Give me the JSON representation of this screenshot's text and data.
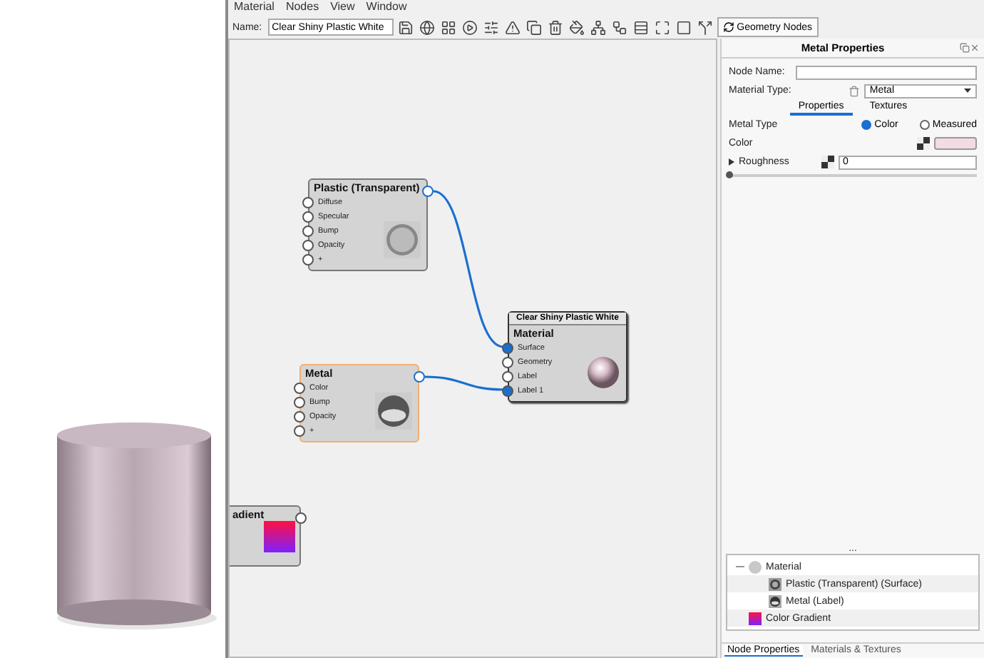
{
  "menu": [
    "Material",
    "Nodes",
    "View",
    "Window"
  ],
  "toolbar": {
    "name_label": "Name:",
    "name_value": "Clear Shiny Plastic White",
    "button": "Geometry Nodes"
  },
  "canvas": {
    "nodes": [
      {
        "kind": "shader",
        "title": "Plastic (Transparent)",
        "selected": false,
        "output_connected": true,
        "thumbnail": {
          "kind": "glass"
        },
        "inputs": [
          {
            "label": "Diffuse",
            "connected": false
          },
          {
            "label": "Specular",
            "connected": false
          },
          {
            "label": "Bump",
            "connected": false
          },
          {
            "label": "Opacity",
            "connected": false
          },
          {
            "label": "+",
            "connected": false
          }
        ]
      },
      {
        "kind": "material",
        "header": "Clear Shiny Plastic White",
        "title": "Material",
        "selected": false,
        "thumbnail": {
          "kind": "sphere"
        },
        "inputs": [
          {
            "label": "Surface",
            "connected": true
          },
          {
            "label": "Geometry",
            "connected": false
          },
          {
            "label": "Label",
            "connected": false
          },
          {
            "label": "Label 1",
            "connected": true
          }
        ]
      },
      {
        "kind": "shader",
        "title": "Metal",
        "selected": true,
        "output_connected": true,
        "thumbnail": {
          "kind": "chrome"
        },
        "inputs": [
          {
            "label": "Color",
            "connected": false
          },
          {
            "label": "Bump",
            "connected": false
          },
          {
            "label": "Opacity",
            "connected": false
          },
          {
            "label": "+",
            "connected": false
          }
        ]
      },
      {
        "kind": "shader",
        "title": "adient",
        "selected": false,
        "output_connected": false,
        "thumbnail": {
          "kind": "gradient"
        }
      }
    ]
  },
  "properties": {
    "title": "Metal Properties",
    "node_name_label": "Node Name:",
    "material_type_label": "Material Type:",
    "material_type_value": "Metal",
    "tabs": [
      {
        "label": "Properties",
        "selected": true
      },
      {
        "label": "Textures",
        "selected": false
      }
    ],
    "metal_type_label": "Metal Type",
    "metal_type_options": [
      {
        "label": "Color",
        "selected": true
      },
      {
        "label": "Measured",
        "selected": false
      }
    ],
    "color_label": "Color",
    "color": "#f2dbe3",
    "roughness": {
      "label": "Roughness",
      "value": "0",
      "level": 0,
      "expanded": false
    }
  },
  "splitter": "...",
  "tree": [
    {
      "kind": "material",
      "label": "Material",
      "expanded": true,
      "children": [
        {
          "kind": "glass",
          "label": "Plastic (Transparent) (Surface)"
        },
        {
          "kind": "chrome",
          "label": "Metal (Label)"
        }
      ]
    },
    {
      "kind": "gradient",
      "label": "Color Gradient"
    }
  ],
  "bottom_tabs": [
    {
      "label": "Node Properties",
      "selected": true
    },
    {
      "label": "Materials & Textures",
      "selected": false
    }
  ]
}
